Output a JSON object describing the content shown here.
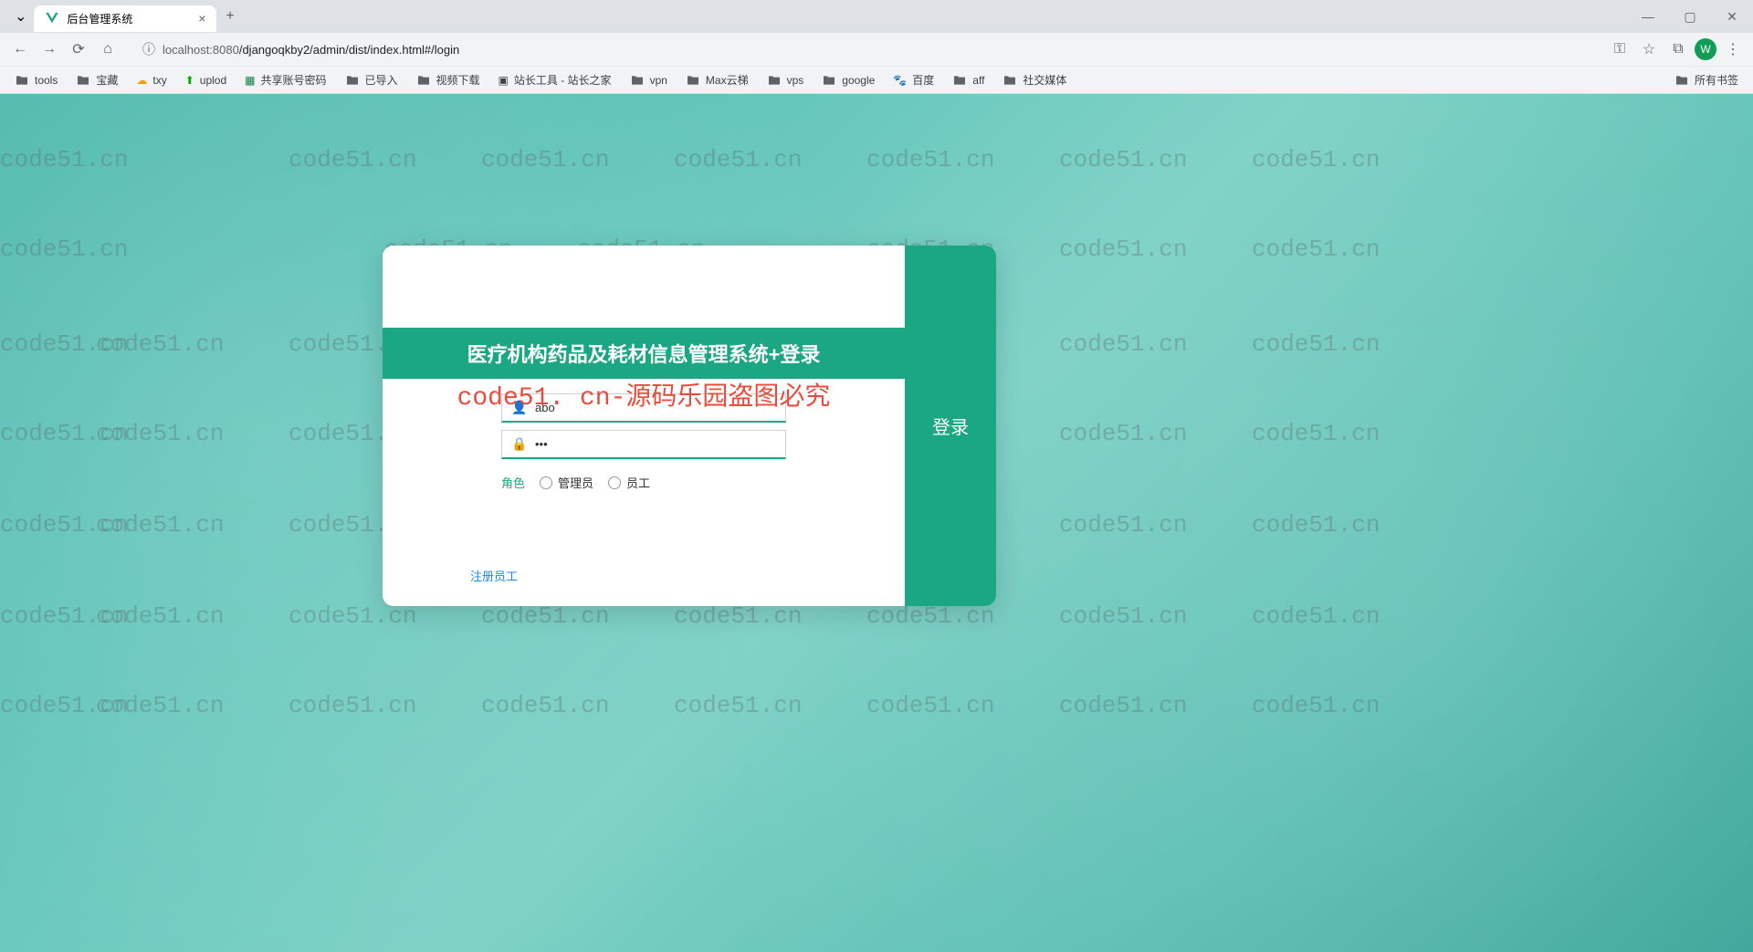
{
  "browser": {
    "tab_title": "后台管理系统",
    "url_host": "localhost:8080",
    "url_path": "/djangoqkby2/admin/dist/index.html#/login",
    "avatar_letter": "W",
    "all_bookmarks": "所有书签",
    "bookmarks": [
      {
        "label": "tools",
        "type": "folder"
      },
      {
        "label": "宝藏",
        "type": "folder"
      },
      {
        "label": "txy",
        "type": "icon"
      },
      {
        "label": "uplod",
        "type": "icon"
      },
      {
        "label": "共享账号密码",
        "type": "doc"
      },
      {
        "label": "已导入",
        "type": "folder"
      },
      {
        "label": "视频下载",
        "type": "folder"
      },
      {
        "label": "站长工具 - 站长之家",
        "type": "icon"
      },
      {
        "label": "vpn",
        "type": "folder"
      },
      {
        "label": "Max云梯",
        "type": "folder"
      },
      {
        "label": "vps",
        "type": "folder"
      },
      {
        "label": "google",
        "type": "folder"
      },
      {
        "label": "百度",
        "type": "icon"
      },
      {
        "label": "aff",
        "type": "folder"
      },
      {
        "label": "社交媒体",
        "type": "folder"
      }
    ]
  },
  "login": {
    "title": "医疗机构药品及耗材信息管理系统+登录",
    "watermark_overlay": "code51. cn-源码乐园盗图必究",
    "username_value": "abo",
    "password_value": "•••",
    "role_label": "角色",
    "role_admin": "管理员",
    "role_staff": "员工",
    "register_link": "注册员工",
    "login_button": "登录"
  },
  "watermark": "code51.cn"
}
